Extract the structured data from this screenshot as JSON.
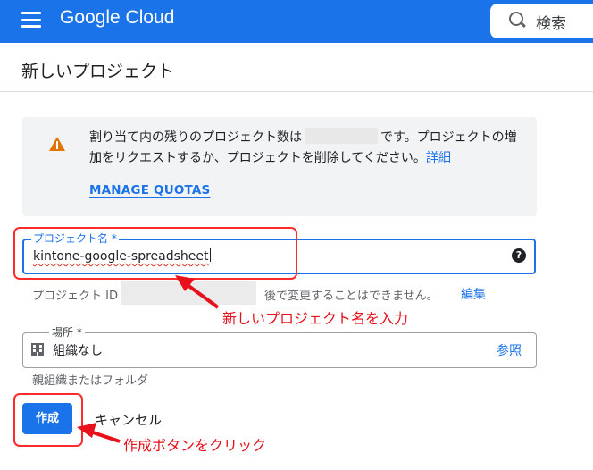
{
  "header": {
    "brand": "Google Cloud",
    "search_label": "検索"
  },
  "page": {
    "title": "新しいプロジェクト"
  },
  "quota_notice": {
    "text_before": "割り当て内の残りのプロジェクト数は",
    "text_after": "です。プロジェクトの増加をリクエストするか、プロジェクトを削除してください。",
    "detail_link": "詳細",
    "manage_link": "MANAGE QUOTAS"
  },
  "project_name": {
    "label": "プロジェクト名 *",
    "value": "kintone-google-spreadsheet",
    "help": "?"
  },
  "project_id": {
    "label": "プロジェクト ID",
    "note": "後で変更することはできません。",
    "edit_link": "編集"
  },
  "location": {
    "label": "場所 *",
    "value": "組織なし",
    "browse_link": "参照",
    "hint": "親組織またはフォルダ"
  },
  "actions": {
    "create": "作成",
    "cancel": "キャンセル"
  },
  "annotations": {
    "name_callout": "新しいプロジェクト名を入力",
    "create_callout": "作成ボタンをクリック",
    "color": "#ff2a2a"
  },
  "colors": {
    "brand_blue": "#1a73e8",
    "warning": "#e37400"
  }
}
